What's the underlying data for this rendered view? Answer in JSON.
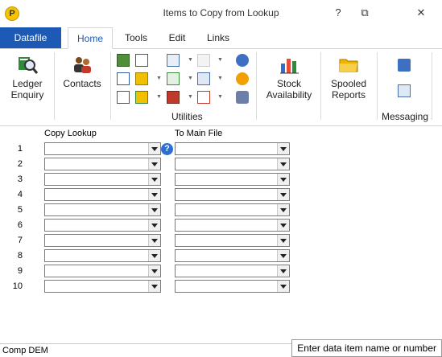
{
  "window": {
    "title": "Items to Copy from Lookup",
    "help_glyph": "?",
    "restore_glyph": "⧉",
    "close_glyph": "✕",
    "logo_letter": "P"
  },
  "tabs": [
    {
      "label": "Datafile"
    },
    {
      "label": "Home"
    },
    {
      "label": "Tools"
    },
    {
      "label": "Edit"
    },
    {
      "label": "Links"
    }
  ],
  "ribbon": {
    "ledger": {
      "line1": "Ledger",
      "line2": "Enquiry"
    },
    "contacts": {
      "label": "Contacts"
    },
    "utilities": {
      "label": "Utilities"
    },
    "stock": {
      "line1": "Stock",
      "line2": "Availability"
    },
    "spooled": {
      "line1": "Spooled",
      "line2": "Reports"
    },
    "messaging": {
      "label": "Messaging"
    }
  },
  "grid": {
    "col1_header": "Copy Lookup",
    "col2_header": "To Main File",
    "rows": [
      "1",
      "2",
      "3",
      "4",
      "5",
      "6",
      "7",
      "8",
      "9",
      "10"
    ],
    "help_glyph": "?"
  },
  "status": {
    "left": "Comp DEM",
    "right": "Enter data item name or number"
  },
  "colors": {
    "accent": "#1c5ab5"
  }
}
